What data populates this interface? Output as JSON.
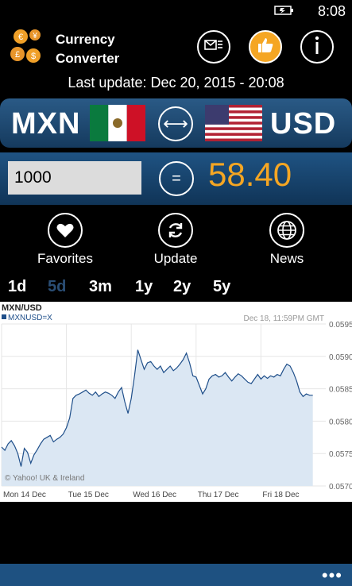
{
  "status": {
    "time": "8:08",
    "battery_icon": "battery-charging-icon"
  },
  "app": {
    "title_line1": "Currency",
    "title_line2": "Converter"
  },
  "last_update": {
    "text": "Last update:  Dec 20, 2015 - 20:08"
  },
  "pair": {
    "from_code": "MXN",
    "to_code": "USD",
    "swap_symbol": "⟷"
  },
  "converter": {
    "amount": "1000",
    "equals": "=",
    "result": "58.40"
  },
  "actions": [
    {
      "label": "Favorites"
    },
    {
      "label": "Update"
    },
    {
      "label": "News"
    }
  ],
  "ranges": [
    "1d",
    "5d",
    "3m",
    "1y",
    "2y",
    "5y"
  ],
  "active_range": "5d",
  "appbar": {
    "more": "•••"
  },
  "colors": {
    "accent": "#f5a623",
    "bar": "#1e5181",
    "line": "#1f4f8a",
    "fill": "#dbe7f3"
  },
  "chart_data": {
    "type": "area",
    "title": "MXN/USD",
    "series_label": "MXNUSD=X",
    "timestamp": "Dec 18, 11:59PM GMT",
    "credit": "© Yahoo! UK & Ireland",
    "categories": [
      "Mon 14 Dec",
      "Tue 15 Dec",
      "Wed 16 Dec",
      "Thu 17 Dec",
      "Fri 18 Dec"
    ],
    "y_ticks": [
      "0.0595",
      "0.0590",
      "0.0585",
      "0.0580",
      "0.0575",
      "0.0570"
    ],
    "ylim": [
      0.057,
      0.0595
    ],
    "grid": true,
    "series": [
      {
        "x": [
          0,
          0.05,
          0.1,
          0.15,
          0.2,
          0.25,
          0.3,
          0.35,
          0.4,
          0.45,
          0.5,
          0.55,
          0.6,
          0.65,
          0.7,
          0.75,
          0.8,
          0.85,
          0.9,
          0.95,
          1.0,
          1.05,
          1.1,
          1.15,
          1.2,
          1.25,
          1.3,
          1.35,
          1.4,
          1.45,
          1.5,
          1.55,
          1.6,
          1.65,
          1.7,
          1.75,
          1.8,
          1.85,
          1.9,
          1.95,
          2.0,
          2.05,
          2.1,
          2.15,
          2.2,
          2.25,
          2.3,
          2.35,
          2.4,
          2.45,
          2.5,
          2.55,
          2.6,
          2.65,
          2.7,
          2.75,
          2.8,
          2.85,
          2.9,
          2.95,
          3.0,
          3.05,
          3.1,
          3.15,
          3.2,
          3.25,
          3.3,
          3.35,
          3.4,
          3.45,
          3.5,
          3.55,
          3.6,
          3.65,
          3.7,
          3.75,
          3.8,
          3.85,
          3.9,
          3.95,
          4.0,
          4.05,
          4.1,
          4.15,
          4.2,
          4.25,
          4.3,
          4.35,
          4.4,
          4.45,
          4.5,
          4.55,
          4.6,
          4.65,
          4.7,
          4.75,
          4.8
        ],
        "values": [
          0.0576,
          0.05755,
          0.05765,
          0.0577,
          0.05762,
          0.0575,
          0.0573,
          0.05758,
          0.05752,
          0.05735,
          0.05748,
          0.05756,
          0.05765,
          0.05772,
          0.05775,
          0.05778,
          0.05768,
          0.05772,
          0.05775,
          0.0578,
          0.0579,
          0.05805,
          0.05835,
          0.0584,
          0.05842,
          0.05845,
          0.05848,
          0.05843,
          0.0584,
          0.05845,
          0.05838,
          0.05842,
          0.05845,
          0.05843,
          0.0584,
          0.05835,
          0.05845,
          0.05852,
          0.0583,
          0.05812,
          0.05835,
          0.0587,
          0.0591,
          0.05895,
          0.0588,
          0.0589,
          0.05892,
          0.05885,
          0.0588,
          0.05885,
          0.05875,
          0.0588,
          0.05885,
          0.05878,
          0.05882,
          0.05888,
          0.05895,
          0.05905,
          0.0589,
          0.0587,
          0.05868,
          0.05855,
          0.05842,
          0.0585,
          0.05865,
          0.0587,
          0.05872,
          0.05868,
          0.0587,
          0.05875,
          0.05868,
          0.05862,
          0.05868,
          0.05873,
          0.0587,
          0.05865,
          0.0586,
          0.05858,
          0.05865,
          0.05872,
          0.05865,
          0.0587,
          0.05866,
          0.0587,
          0.05868,
          0.05872,
          0.0587,
          0.0588,
          0.05888,
          0.05885,
          0.05875,
          0.05862,
          0.05845,
          0.05838,
          0.05842,
          0.0584,
          0.0584
        ]
      }
    ]
  }
}
